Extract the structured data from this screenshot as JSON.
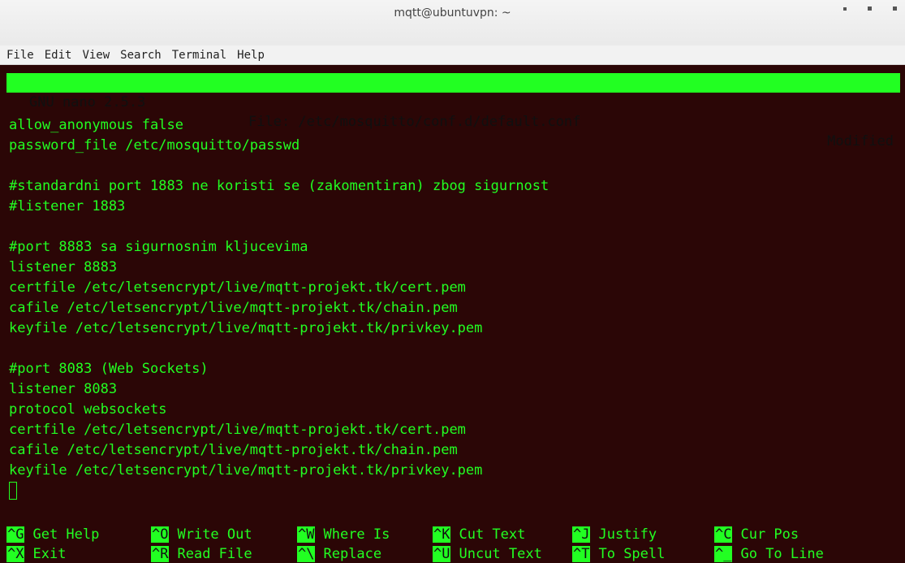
{
  "window": {
    "title": "mqtt@ubuntuvpn: ~"
  },
  "menu": [
    "File",
    "Edit",
    "View",
    "Search",
    "Terminal",
    "Help"
  ],
  "nano": {
    "version": "GNU nano 2.5.3",
    "file_label": "File: /etc/mosquitto/conf.d/default.conf",
    "status": "Modified"
  },
  "content_lines": [
    "",
    "allow_anonymous false",
    "password_file /etc/mosquitto/passwd",
    "",
    "#standardni port 1883 ne koristi se (zakomentiran) zbog sigurnost",
    "#listener 1883",
    "",
    "#port 8883 sa sigurnosnim kljucevima",
    "listener 8883",
    "certfile /etc/letsencrypt/live/mqtt-projekt.tk/cert.pem",
    "cafile /etc/letsencrypt/live/mqtt-projekt.tk/chain.pem",
    "keyfile /etc/letsencrypt/live/mqtt-projekt.tk/privkey.pem",
    "",
    "#port 8083 (Web Sockets)",
    "listener 8083",
    "protocol websockets",
    "certfile /etc/letsencrypt/live/mqtt-projekt.tk/cert.pem",
    "cafile /etc/letsencrypt/live/mqtt-projekt.tk/chain.pem",
    "keyfile /etc/letsencrypt/live/mqtt-projekt.tk/privkey.pem"
  ],
  "shortcuts": {
    "row1": [
      {
        "key": "^G",
        "label": "Get Help"
      },
      {
        "key": "^O",
        "label": "Write Out"
      },
      {
        "key": "^W",
        "label": "Where Is"
      },
      {
        "key": "^K",
        "label": "Cut Text"
      },
      {
        "key": "^J",
        "label": "Justify"
      },
      {
        "key": "^C",
        "label": "Cur Pos"
      }
    ],
    "row2": [
      {
        "key": "^X",
        "label": "Exit"
      },
      {
        "key": "^R",
        "label": "Read File"
      },
      {
        "key": "^\\",
        "label": "Replace"
      },
      {
        "key": "^U",
        "label": "Uncut Text"
      },
      {
        "key": "^T",
        "label": "To Spell"
      },
      {
        "key": "^_",
        "label": "Go To Line"
      }
    ]
  },
  "colors": {
    "terminal_bg": "#2b0606",
    "text": "#22ff22"
  }
}
